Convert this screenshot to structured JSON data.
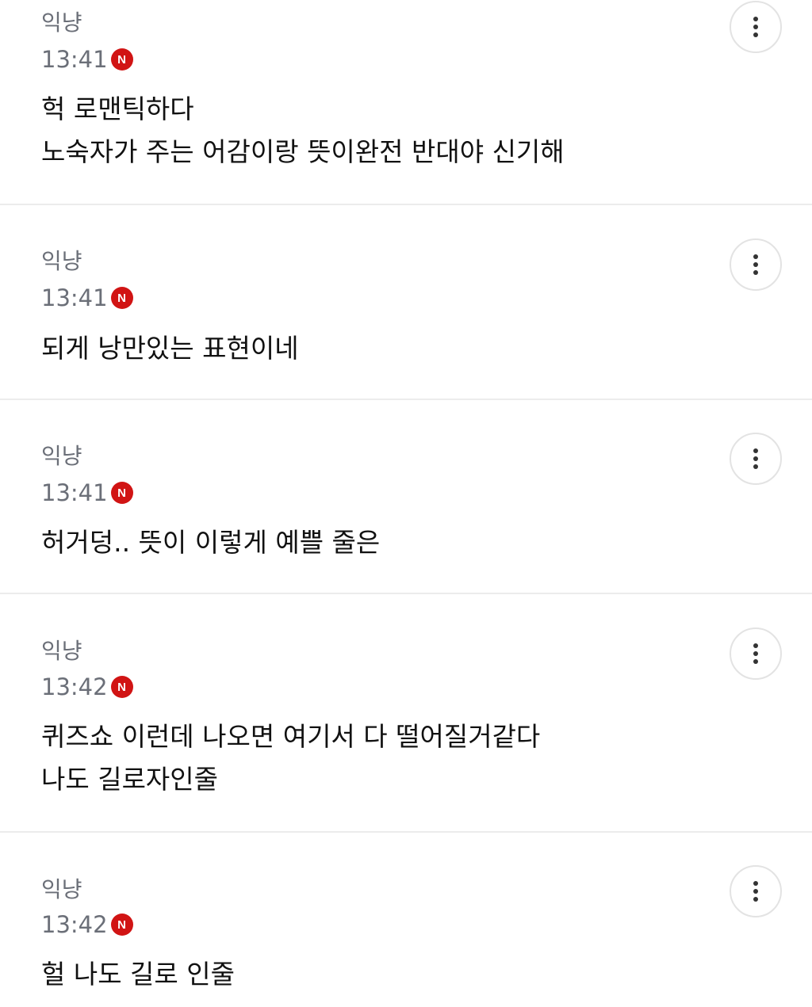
{
  "comments": [
    {
      "author": "익냥",
      "time": "13:41",
      "badge": "N",
      "lines": [
        "헉 로맨틱하다",
        "노숙자가 주는 어감이랑 뜻이완전 반대야 신기해"
      ]
    },
    {
      "author": "익냥",
      "time": "13:41",
      "badge": "N",
      "lines": [
        "되게 낭만있는 표현이네"
      ]
    },
    {
      "author": "익냥",
      "time": "13:41",
      "badge": "N",
      "lines": [
        "허거덩.. 뜻이 이렇게 예쁠 줄은"
      ]
    },
    {
      "author": "익냥",
      "time": "13:42",
      "badge": "N",
      "lines": [
        "퀴즈쇼 이런데 나오면 여기서 다 떨어질거같다",
        "나도 길로자인줄"
      ]
    },
    {
      "author": "익냥",
      "time": "13:42",
      "badge": "N",
      "lines": [
        "헐 나도 길로 인줄"
      ]
    }
  ],
  "colors": {
    "badge": "#d11414",
    "meta_text": "#6b6f78",
    "body_text": "#111111",
    "divider": "#ececec"
  },
  "icons": {
    "more": "more-vertical-icon"
  }
}
